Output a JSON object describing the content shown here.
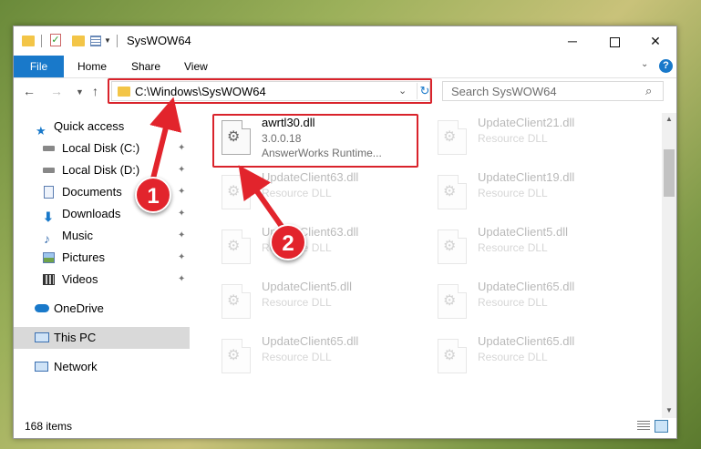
{
  "window": {
    "title": "SysWOW64",
    "controls": {
      "minimize": "─",
      "close": "✕"
    }
  },
  "ribbon": {
    "tabs": {
      "file": "File",
      "home": "Home",
      "share": "Share",
      "view": "View"
    },
    "help": "?"
  },
  "navbar": {
    "back": "←",
    "forward": "→",
    "recent": "⌄",
    "up": "↑",
    "address": "C:\\Windows\\SysWOW64",
    "refresh": "↻",
    "search_placeholder": "Search SysWOW64",
    "search_icon": "⌕"
  },
  "sidebar": {
    "items": [
      {
        "label": "Quick access",
        "icon": "star-icon"
      },
      {
        "label": "Local Disk (C:)",
        "icon": "drive-icon",
        "pinned": true
      },
      {
        "label": "Local Disk (D:)",
        "icon": "drive-icon",
        "pinned": true
      },
      {
        "label": "Documents",
        "icon": "documents-icon",
        "pinned": true
      },
      {
        "label": "Downloads",
        "icon": "download-icon",
        "pinned": true
      },
      {
        "label": "Music",
        "icon": "music-icon",
        "pinned": true
      },
      {
        "label": "Pictures",
        "icon": "pictures-icon",
        "pinned": true
      },
      {
        "label": "Videos",
        "icon": "videos-icon",
        "pinned": true
      },
      {
        "label": "OneDrive",
        "icon": "cloud-icon"
      },
      {
        "label": "This PC",
        "icon": "computer-icon",
        "selected": true
      },
      {
        "label": "Network",
        "icon": "network-icon"
      }
    ],
    "pin_glyph": "📌"
  },
  "files": {
    "highlighted": {
      "name": "awrtl30.dll",
      "version": "3.0.0.18",
      "description": "AnswerWorks Runtime..."
    },
    "left_column": [
      {
        "name": "UpdateClient63.dll",
        "type": "Resource DLL"
      },
      {
        "name": "UpdateClient63.dll",
        "type": "Resource DLL"
      },
      {
        "name": "UpdateClient5.dll",
        "type": "Resource DLL"
      },
      {
        "name": "UpdateClient65.dll",
        "type": "Resource DLL"
      }
    ],
    "right_column": [
      {
        "name": "UpdateClient21.dll",
        "type": "Resource DLL"
      },
      {
        "name": "UpdateClient19.dll",
        "type": "Resource DLL"
      },
      {
        "name": "UpdateClient5.dll",
        "type": "Resource DLL"
      },
      {
        "name": "UpdateClient65.dll",
        "type": "Resource DLL"
      },
      {
        "name": "UpdateClient65.dll",
        "type": "Resource DLL"
      }
    ],
    "gear_glyph": "⚙"
  },
  "scrollbar": {
    "up": "▲",
    "down": "▼"
  },
  "status": {
    "count": "168 items"
  },
  "annotations": {
    "step1": "1",
    "step2": "2",
    "color": "#e2242c"
  }
}
